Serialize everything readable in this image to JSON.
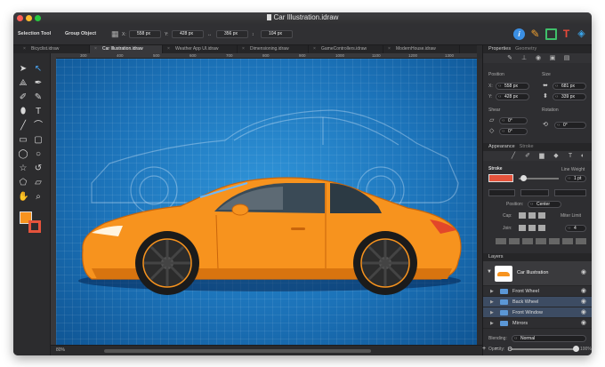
{
  "window": {
    "title": "Car Illustration.idraw"
  },
  "toolbar": {
    "selection_tool": "Selection Tool",
    "group_object": "Group Object",
    "x_label": "X:",
    "x_value": "558 px",
    "y_label": "Y:",
    "y_value": "428 px",
    "w_label": "↔",
    "w_value": "356 px",
    "h_label": "↕",
    "h_value": "104 px"
  },
  "tabs": [
    {
      "label": "Bicyclist.idraw"
    },
    {
      "label": "Car Illustration.idraw"
    },
    {
      "label": "Weather App UI.idraw"
    },
    {
      "label": "Dimensioning.idraw"
    },
    {
      "label": "GameControllers.idraw"
    },
    {
      "label": "ModernHouse.idraw"
    }
  ],
  "ruler_ticks": [
    "300",
    "400",
    "500",
    "600",
    "700",
    "800",
    "900",
    "1000",
    "1100",
    "1200",
    "1300"
  ],
  "status": {
    "zoom": "80%"
  },
  "inspector": {
    "header": "Properties",
    "header_sub": "Geometry",
    "position_label": "Position",
    "size_label": "Size",
    "pos_x_label": "X:",
    "pos_x": "558 px",
    "pos_y_label": "Y:",
    "pos_y": "428 px",
    "size_w": "681 px",
    "size_h": "339 px",
    "shear_label": "Shear",
    "rotation_label": "Rotation",
    "shear_x": "0°",
    "shear_y": "0°",
    "rotation": "0°",
    "appearance_header": "Appearance",
    "appearance_sub": "Stroke",
    "stroke_label": "Stroke",
    "line_weight_label": "Line Weight",
    "line_weight": "1 pt",
    "position_field_label": "Position:",
    "position_field": "Center",
    "cap_label": "Cap:",
    "join_label": "Join:",
    "miter_label": "Miter Limit",
    "miter": "4",
    "layers_header": "Layers",
    "layers": [
      {
        "name": "Car Illustration"
      },
      {
        "name": "Front Wheel"
      },
      {
        "name": "Back Wheel"
      },
      {
        "name": "Front Window"
      },
      {
        "name": "Mirrors"
      }
    ],
    "blending_label": "Blending:",
    "blending": "Normal",
    "opacity_label": "Opacity:",
    "opacity": "100%",
    "add_btn": "+",
    "remove_btn": "−",
    "gear_btn": "⚙"
  },
  "colors": {
    "accent": "#3d7fd4",
    "car": "#f7931e",
    "canvas": "#1c73b9",
    "stroke_swatch": "#e5533c"
  }
}
